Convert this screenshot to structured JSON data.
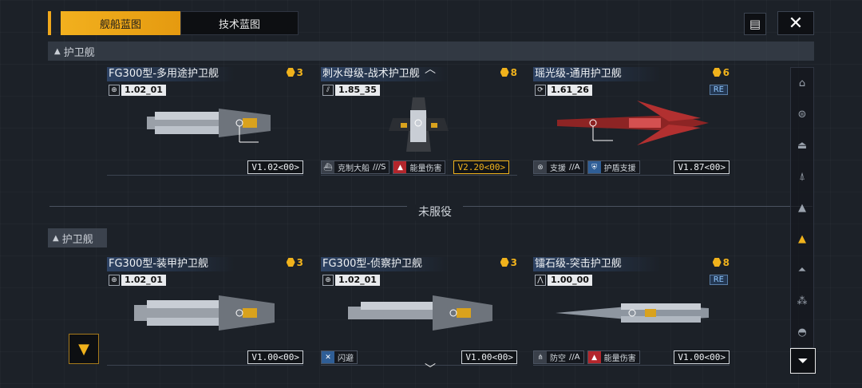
{
  "tabs": {
    "active": "舰船蓝图",
    "inactive": "技术蓝图"
  },
  "toolbar": {
    "doc_icon": "document-icon",
    "close_icon": "close-icon"
  },
  "sections": [
    {
      "label": "护卫舰"
    },
    {
      "label": "护卫舰"
    }
  ],
  "divider": {
    "label": "未服役"
  },
  "cards": [
    {
      "title": "FG300型-多用途护卫舰",
      "cost": "3",
      "ver_icon": "globe-icon",
      "ver": "1.02_01",
      "version": "V1.02<00>",
      "tags": [],
      "re": ""
    },
    {
      "title": "刺水母级-战术护卫舰",
      "cost": "8",
      "ver_icon": "stripe-icon",
      "ver": "1.85_35",
      "version": "V2.20<00>",
      "tags": [
        {
          "icon": "ship-icon",
          "text": "克制大船",
          "grade": "///S"
        },
        {
          "icon": "energy-icon",
          "text": "能量伤害",
          "grade": ""
        }
      ],
      "re": ""
    },
    {
      "title": "瑶光级-通用护卫舰",
      "cost": "6",
      "ver_icon": "swirl-icon",
      "ver": "1.61_26",
      "version": "V1.87<00>",
      "tags": [
        {
          "icon": "support-icon",
          "text": "支援",
          "grade": "//A"
        },
        {
          "icon": "shield-icon",
          "text": "护盾支援",
          "grade": ""
        }
      ],
      "re": "RE"
    },
    {
      "title": "FG300型-装甲护卫舰",
      "cost": "3",
      "ver_icon": "globe-icon",
      "ver": "1.02_01",
      "version": "V1.00<00>",
      "tags": [],
      "re": ""
    },
    {
      "title": "FG300型-侦察护卫舰",
      "cost": "3",
      "ver_icon": "globe-icon",
      "ver": "1.02_01",
      "version": "V1.00<00>",
      "tags": [
        {
          "icon": "dodge-icon",
          "text": "闪避",
          "grade": ""
        }
      ],
      "re": ""
    },
    {
      "title": "镭石级-突击护卫舰",
      "cost": "8",
      "ver_icon": "antenna-icon",
      "ver": "1.00_00",
      "version": "V1.00<00>",
      "tags": [
        {
          "icon": "antiair-icon",
          "text": "防空",
          "grade": "//A"
        },
        {
          "icon": "energy-icon",
          "text": "能量伤害",
          "grade": ""
        }
      ],
      "re": "RE"
    }
  ],
  "sidebar": [
    {
      "icon": "battleship-icon",
      "active": false
    },
    {
      "icon": "carrier-icon",
      "active": false
    },
    {
      "icon": "cruiser-icon",
      "active": false
    },
    {
      "icon": "destroyer-icon",
      "active": false
    },
    {
      "icon": "corvette-icon",
      "active": false
    },
    {
      "icon": "frigate-icon",
      "active": true
    },
    {
      "icon": "fighter-icon",
      "active": false
    },
    {
      "icon": "squad-icon",
      "active": false
    },
    {
      "icon": "station-icon",
      "active": false
    }
  ],
  "colors": {
    "accent": "#f0b21c",
    "bg": "#1c2128",
    "energy": "#b3262c",
    "shield": "#2f5e96"
  }
}
